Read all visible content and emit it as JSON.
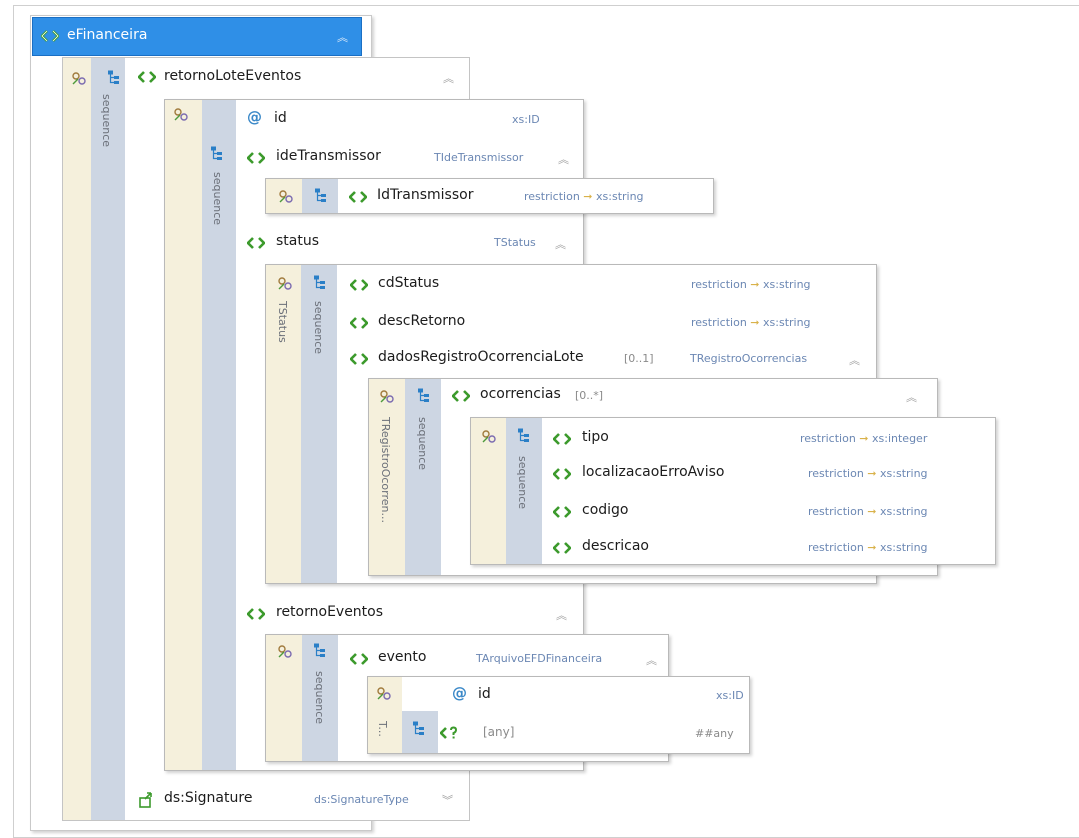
{
  "root": {
    "label": "eFinanceira"
  },
  "retornoLoteEventos": {
    "label": "retornoLoteEventos",
    "seq": "sequence"
  },
  "rle_inner": {
    "seq": "sequence"
  },
  "id1": {
    "label": "id",
    "type": "xs:ID"
  },
  "ideTransmissor": {
    "label": "ideTransmissor",
    "type": "TIdeTransmissor"
  },
  "IdTransmissor": {
    "label": "IdTransmissor",
    "type": "restriction",
    "base": "xs:string"
  },
  "status": {
    "label": "status",
    "type": "TStatus",
    "strip": "TStatus",
    "seq": "sequence"
  },
  "cdStatus": {
    "label": "cdStatus",
    "type": "restriction",
    "base": "xs:string"
  },
  "descRetorno": {
    "label": "descRetorno",
    "type": "restriction",
    "base": "xs:string"
  },
  "dadosRegistro": {
    "label": "dadosRegistroOcorrenciaLote",
    "mult": "[0..1]",
    "type": "TRegistroOcorrencias"
  },
  "reg_box": {
    "strip": "TRegistroOcorren...",
    "seq": "sequence"
  },
  "ocorrencias": {
    "label": "ocorrencias",
    "mult": "[0..*]"
  },
  "oc_box": {
    "seq": "sequence"
  },
  "tipo": {
    "label": "tipo",
    "type": "restriction",
    "base": "xs:integer"
  },
  "localizacao": {
    "label": "localizacaoErroAviso",
    "type": "restriction",
    "base": "xs:string"
  },
  "codigo": {
    "label": "codigo",
    "type": "restriction",
    "base": "xs:string"
  },
  "descricao": {
    "label": "descricao",
    "type": "restriction",
    "base": "xs:string"
  },
  "retornoEventos": {
    "label": "retornoEventos",
    "seq": "sequence"
  },
  "evento": {
    "label": "evento",
    "type": "TArquivoEFDFinanceira"
  },
  "ev_box": {
    "strip": "T...",
    "id_label": "id",
    "id_type": "xs:ID",
    "any_label": "[any]",
    "any_type": "##any"
  },
  "signature": {
    "label": "ds:Signature",
    "type": "ds:SignatureType"
  },
  "colors": {
    "element_icon": "#3c9a2c",
    "attribute_icon": "#3a88c8",
    "type_text": "#6b87b3",
    "root_header": "#2f8fe7"
  }
}
